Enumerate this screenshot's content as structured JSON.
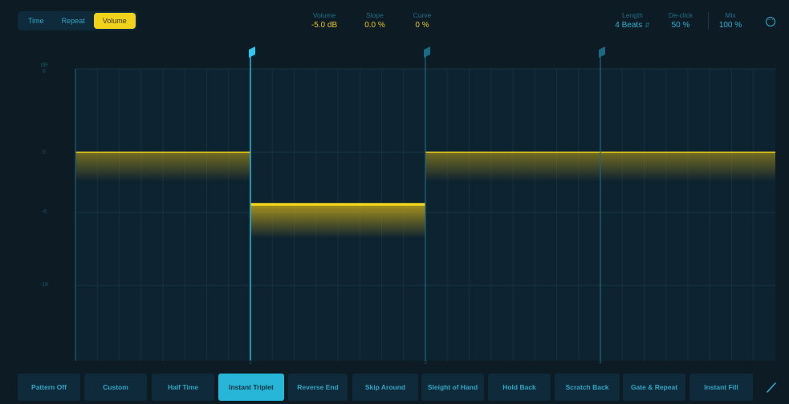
{
  "modes": {
    "items": [
      {
        "label": "Time"
      },
      {
        "label": "Repeat"
      },
      {
        "label": "Volume",
        "active": true
      }
    ]
  },
  "params": {
    "volume": {
      "label": "Volume",
      "value": "-5.0 dB"
    },
    "slope": {
      "label": "Slope",
      "value": "0.0 %"
    },
    "curve": {
      "label": "Curve",
      "value": "0 %"
    },
    "length": {
      "label": "Length",
      "value": "4 Beats"
    },
    "declick": {
      "label": "De-click",
      "value": "50 %"
    },
    "mix": {
      "label": "Mix",
      "value": "100 %"
    }
  },
  "graph": {
    "unit_label": "dB",
    "y_ticks": [
      "6",
      "0",
      "-6",
      "-18"
    ],
    "beat_labels": [
      "2",
      "3",
      "4"
    ],
    "segments_db": [
      0,
      -5,
      0,
      0
    ]
  },
  "patterns": [
    {
      "label": "Pattern Off"
    },
    {
      "label": "Custom"
    },
    {
      "label": "Half Time"
    },
    {
      "label": "Instant Triplet",
      "active": true
    },
    {
      "label": "Reverse End"
    },
    {
      "label": "Skip Around"
    },
    {
      "label": "Sleight of Hand"
    },
    {
      "label": "Hold Back"
    },
    {
      "label": "Scratch Back"
    },
    {
      "label": "Gate & Repeat"
    },
    {
      "label": "Instant Fill"
    }
  ],
  "colors": {
    "background": "#0c1b24",
    "accent_yellow": "#f2d31b",
    "accent_blue": "#27b6d8"
  }
}
